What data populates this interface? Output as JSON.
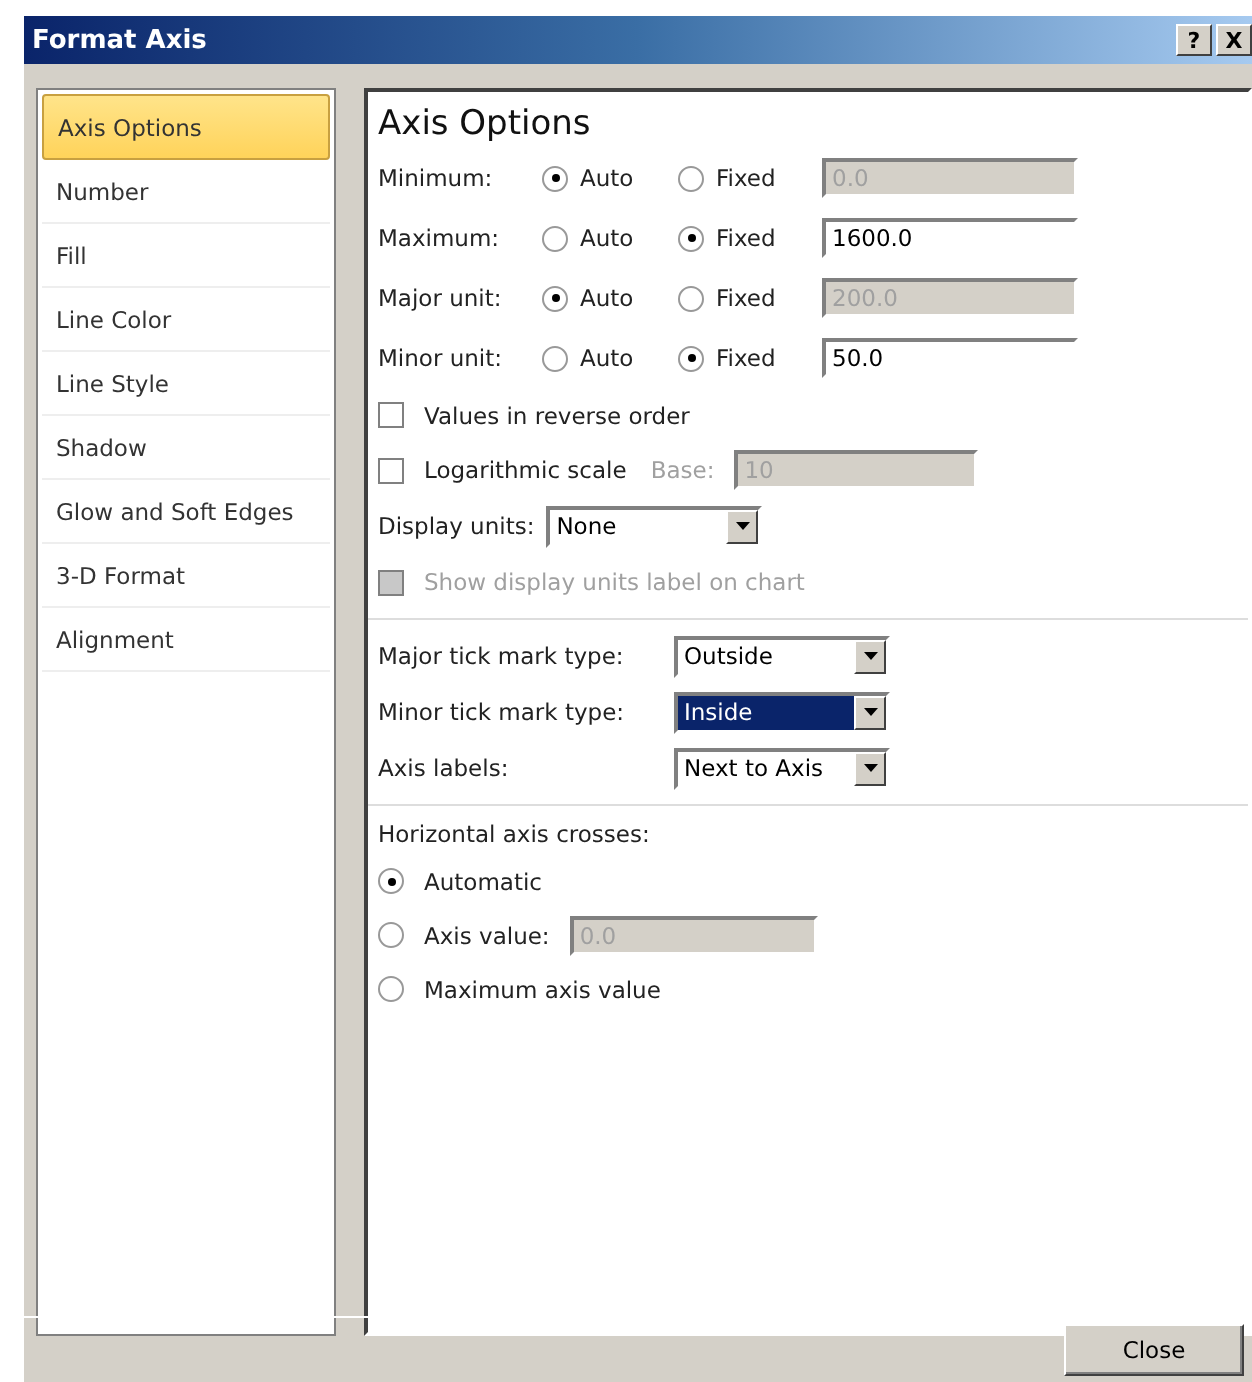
{
  "window": {
    "title": "Format Axis",
    "help_button": "?",
    "close_button": "X"
  },
  "sidebar": {
    "items": [
      {
        "label": "Axis Options",
        "selected": true
      },
      {
        "label": "Number",
        "selected": false
      },
      {
        "label": "Fill",
        "selected": false
      },
      {
        "label": "Line Color",
        "selected": false
      },
      {
        "label": "Line Style",
        "selected": false
      },
      {
        "label": "Shadow",
        "selected": false
      },
      {
        "label": "Glow and Soft Edges",
        "selected": false
      },
      {
        "label": "3-D Format",
        "selected": false
      },
      {
        "label": "Alignment",
        "selected": false
      }
    ]
  },
  "panel": {
    "heading": "Axis Options",
    "bounds": [
      {
        "label": "Minimum:",
        "auto_label": "Auto",
        "fixed_label": "Fixed",
        "fixed": false,
        "value": "0.0"
      },
      {
        "label": "Maximum:",
        "auto_label": "Auto",
        "fixed_label": "Fixed",
        "fixed": true,
        "value": "1600.0"
      },
      {
        "label": "Major unit:",
        "auto_label": "Auto",
        "fixed_label": "Fixed",
        "fixed": false,
        "value": "200.0"
      },
      {
        "label": "Minor unit:",
        "auto_label": "Auto",
        "fixed_label": "Fixed",
        "fixed": true,
        "value": "50.0"
      }
    ],
    "reverse_order": {
      "label": "Values in reverse order",
      "checked": false
    },
    "log_scale": {
      "label": "Logarithmic scale",
      "checked": false,
      "base_label": "Base:",
      "base_value": "10"
    },
    "display_units": {
      "label": "Display units:",
      "value": "None"
    },
    "show_units_label": {
      "label": "Show display units label on chart",
      "checked": false,
      "disabled": true
    },
    "dropdowns": [
      {
        "label": "Major tick mark type:",
        "value": "Outside",
        "selected": false
      },
      {
        "label": "Minor tick mark type:",
        "value": "Inside",
        "selected": true
      },
      {
        "label": "Axis labels:",
        "value": "Next to Axis",
        "selected": false
      }
    ],
    "crosses": {
      "label": "Horizontal axis crosses:",
      "options": [
        {
          "label": "Automatic",
          "selected": true
        },
        {
          "label": "Axis value:",
          "selected": false,
          "value": "0.0"
        },
        {
          "label": "Maximum axis value",
          "selected": false
        }
      ]
    }
  },
  "buttons": [
    "Close"
  ]
}
